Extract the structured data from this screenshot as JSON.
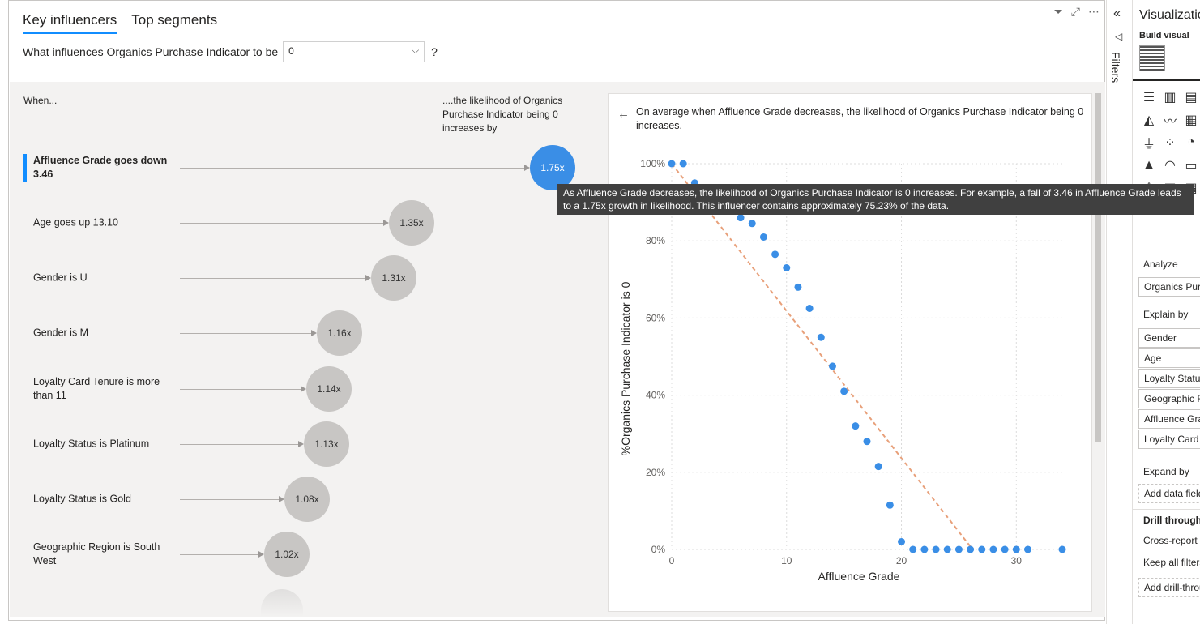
{
  "tabs": [
    "Key influencers",
    "Top segments"
  ],
  "question": {
    "text": "What influences Organics Purchase Indicator to be",
    "value": "0",
    "help": "?"
  },
  "headers": {
    "when": "When...",
    "likelihood": "....the likelihood of Organics Purchase Indicator being 0 increases by"
  },
  "influencers": [
    {
      "label": "Affluence Grade goes down 3.46",
      "value": "1.75x",
      "selected": true
    },
    {
      "label": "Age goes up 13.10",
      "value": "1.35x"
    },
    {
      "label": "Gender is U",
      "value": "1.31x"
    },
    {
      "label": "Gender is M",
      "value": "1.16x"
    },
    {
      "label": "Loyalty Card Tenure is more than 11",
      "value": "1.14x"
    },
    {
      "label": "Loyalty Status is Platinum",
      "value": "1.13x"
    },
    {
      "label": "Loyalty Status is Gold",
      "value": "1.08x"
    },
    {
      "label": "Geographic Region is South West",
      "value": "1.02x"
    }
  ],
  "detail": {
    "description": "On average when Affluence Grade decreases, the likelihood of Organics Purchase Indicator being 0 increases."
  },
  "tooltip": "As Affluence Grade decreases, the likelihood of Organics Purchase Indicator is 0 increases. For example, a fall of 3.46 in Affluence Grade leads to a 1.75x growth in likelihood. This influencer contains approximately 75.23% of the data.",
  "chart_data": {
    "type": "scatter",
    "xlabel": "Affluence Grade",
    "ylabel": "%Organics Purchase Indicator is 0",
    "xlim": [
      0,
      34
    ],
    "ylim": [
      0,
      100
    ],
    "xticks": [
      0,
      10,
      20,
      30
    ],
    "yticks": [
      "0%",
      "20%",
      "40%",
      "60%",
      "80%",
      "100%"
    ],
    "points": [
      [
        0,
        100
      ],
      [
        1,
        100
      ],
      [
        2,
        95
      ],
      [
        6,
        86
      ],
      [
        7,
        84.5
      ],
      [
        8,
        81
      ],
      [
        9,
        76.5
      ],
      [
        10,
        73
      ],
      [
        11,
        68
      ],
      [
        12,
        62.5
      ],
      [
        13,
        55
      ],
      [
        14,
        47.5
      ],
      [
        15,
        41
      ],
      [
        16,
        32
      ],
      [
        17,
        28
      ],
      [
        18,
        21.5
      ],
      [
        19,
        11.5
      ],
      [
        20,
        2
      ],
      [
        21,
        0
      ],
      [
        22,
        0
      ],
      [
        23,
        0
      ],
      [
        24,
        0
      ],
      [
        25,
        0
      ],
      [
        26,
        0
      ],
      [
        27,
        0
      ],
      [
        28,
        0
      ],
      [
        29,
        0
      ],
      [
        30,
        0
      ],
      [
        31,
        0
      ],
      [
        34,
        0
      ]
    ],
    "trend": [
      [
        0,
        100
      ],
      [
        26.2,
        0
      ]
    ],
    "point_color": "#3a8ee6",
    "trend_color": "#e8a07a",
    "grid": true
  },
  "filters_label": "Filters",
  "viz": {
    "title": "Visualizations",
    "build": "Build visual",
    "analyze": "Analyze",
    "analyze_field": "Organics Purchase Indicator",
    "explain": "Explain by",
    "explain_fields": [
      "Gender",
      "Age",
      "Loyalty Status",
      "Geographic Region",
      "Affluence Grade",
      "Loyalty Card Tenure"
    ],
    "expand": "Expand by",
    "expand_placeholder": "Add data fields here",
    "drill": "Drill through",
    "cross": "Cross-report",
    "keep": "Keep all filters",
    "add_drill": "Add drill-through fields here"
  }
}
